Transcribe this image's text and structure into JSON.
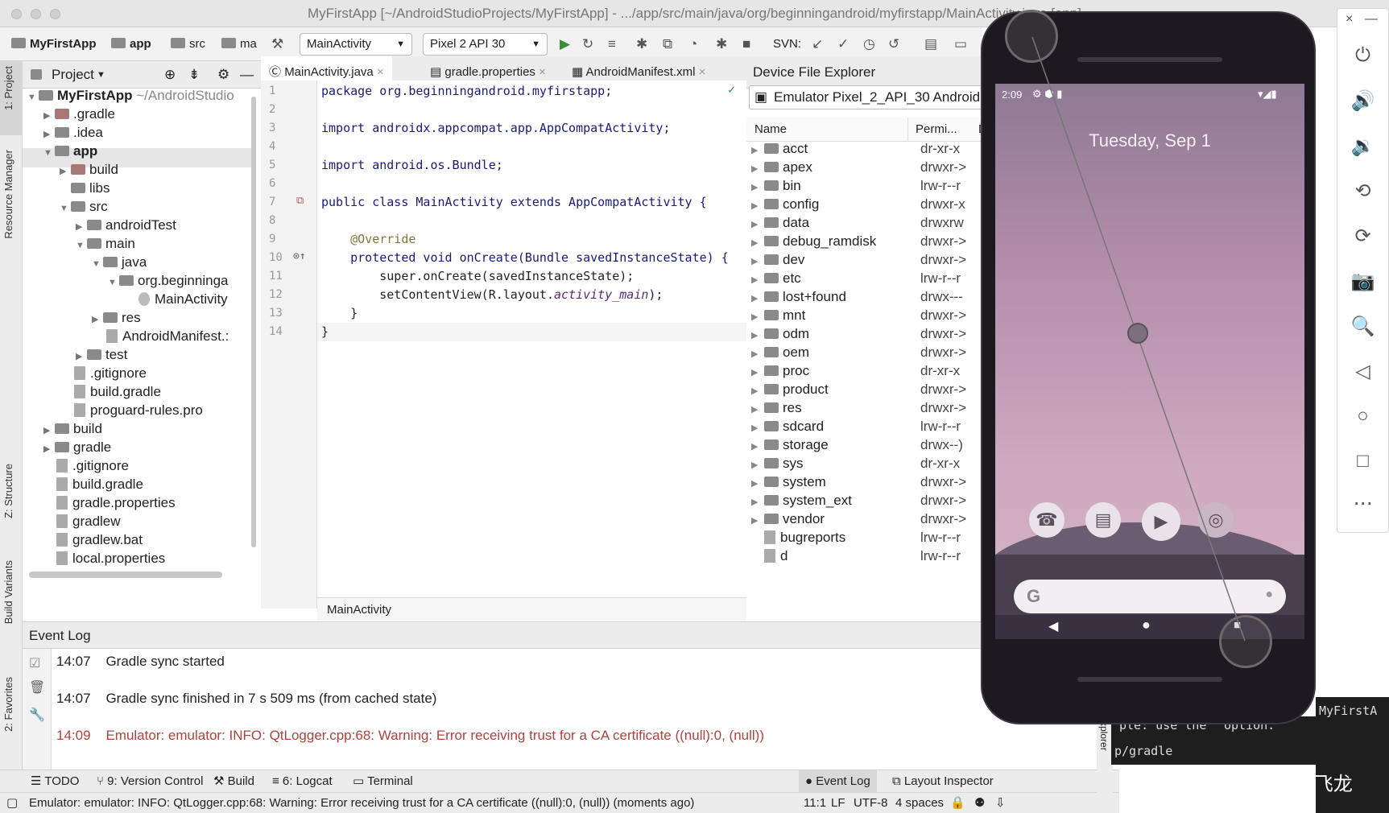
{
  "window": {
    "title": "MyFirstApp [~/AndroidStudioProjects/MyFirstApp] - .../app/src/main/java/org/beginningandroid/myfirstapp/MainActivity.java [app]"
  },
  "toolbar": {
    "breadcrumb": [
      "MyFirstApp",
      "app",
      "src",
      "ma"
    ],
    "run_config": "MainActivity",
    "device": "Pixel 2 API 30",
    "svn_label": "SVN:"
  },
  "side_tabs": [
    "1: Project",
    "Resource Manager",
    "Z: Structure",
    "Build Variants",
    "2: Favorites"
  ],
  "project": {
    "header": "Project",
    "root": "MyFirstApp",
    "root_path": "~/AndroidStudio",
    "items": [
      ".gradle",
      ".idea",
      "app",
      "build",
      "libs",
      "src",
      "androidTest",
      "main",
      "java",
      "org.beginninga",
      "MainActivity",
      "res",
      "AndroidManifest.:",
      "test",
      ".gitignore",
      "build.gradle",
      "proguard-rules.pro",
      "build",
      "gradle",
      ".gitignore",
      "build.gradle",
      "gradle.properties",
      "gradlew",
      "gradlew.bat",
      "local.properties"
    ]
  },
  "editor": {
    "tabs": [
      "MainActivity.java",
      "gradle.properties",
      "AndroidManifest.xml"
    ],
    "line_numbers": [
      "1",
      "2",
      "3",
      "4",
      "5",
      "6",
      "7",
      "8",
      "9",
      "10",
      "11",
      "12",
      "13",
      "14"
    ],
    "lines": [
      "package org.beginningandroid.myfirstapp;",
      "",
      "import androidx.appcompat.app.AppCompatActivity;",
      "",
      "import android.os.Bundle;",
      "",
      "public class MainActivity extends AppCompatActivity {",
      "",
      "    @Override",
      "    protected void onCreate(Bundle savedInstanceState) {",
      "        super.onCreate(savedInstanceState);",
      "        setContentView(R.layout.",
      "    }",
      "}"
    ],
    "line12_italic": "activity_main",
    "line12_tail": ");",
    "footer": "MainActivity"
  },
  "device_explorer": {
    "title": "Device File Explorer",
    "device": "Emulator Pixel_2_API_30 Android",
    "col_name": "Name",
    "col_perm": "Permi...",
    "col_extra": "D",
    "rows": [
      {
        "name": "acct",
        "perm": "dr-xr-x"
      },
      {
        "name": "apex",
        "perm": "drwxr->"
      },
      {
        "name": "bin",
        "perm": "lrw-r--r"
      },
      {
        "name": "config",
        "perm": "drwxr-x"
      },
      {
        "name": "data",
        "perm": "drwxrw"
      },
      {
        "name": "debug_ramdisk",
        "perm": "drwxr->"
      },
      {
        "name": "dev",
        "perm": "drwxr->"
      },
      {
        "name": "etc",
        "perm": "lrw-r--r"
      },
      {
        "name": "lost+found",
        "perm": "drwx---"
      },
      {
        "name": "mnt",
        "perm": "drwxr->"
      },
      {
        "name": "odm",
        "perm": "drwxr->"
      },
      {
        "name": "oem",
        "perm": "drwxr->"
      },
      {
        "name": "proc",
        "perm": "dr-xr-x"
      },
      {
        "name": "product",
        "perm": "drwxr->"
      },
      {
        "name": "res",
        "perm": "drwxr->"
      },
      {
        "name": "sdcard",
        "perm": "lrw-r--r"
      },
      {
        "name": "storage",
        "perm": "drwx--)"
      },
      {
        "name": "sys",
        "perm": "dr-xr-x"
      },
      {
        "name": "system",
        "perm": "drwxr->"
      },
      {
        "name": "system_ext",
        "perm": "drwxr->"
      },
      {
        "name": "vendor",
        "perm": "drwxr->"
      },
      {
        "name": "bugreports",
        "perm": "lrw-r--r"
      },
      {
        "name": "d",
        "perm": "lrw-r--r"
      }
    ]
  },
  "event_log": {
    "title": "Event Log",
    "entries": [
      {
        "time": "14:07",
        "text": "Gradle sync started"
      },
      {
        "time": "14:07",
        "text": "Gradle sync finished in 7 s 509 ms (from cached state)"
      },
      {
        "time": "14:09",
        "text": "Emulator: emulator: INFO: QtLogger.cpp:68: Warning: Error receiving trust for a CA certificate ((null):0, (null))"
      }
    ]
  },
  "bottom_tabs": [
    "TODO",
    "9: Version Control",
    "Build",
    "6: Logcat",
    "Terminal",
    "Event Log",
    "Layout Inspector"
  ],
  "status": {
    "message": "Emulator: emulator: INFO: QtLogger.cpp:68: Warning: Error receiving trust for a CA certificate ((null):0, (null)) (moments ago)",
    "position": "11:1",
    "line_sep": "LF",
    "encoding": "UTF-8",
    "indent": "4 spaces"
  },
  "phone": {
    "time": "2:09",
    "date": "Tuesday, Sep 1",
    "search_g": "G"
  },
  "terminal": {
    "line1": "MyFirstA",
    "line2": "ple: use the",
    "line2b": "option.",
    "line3": "p/gradle",
    "explorer_tab": "Explorer"
  },
  "watermark": "掘金技术社区 @ 布客飞龙"
}
